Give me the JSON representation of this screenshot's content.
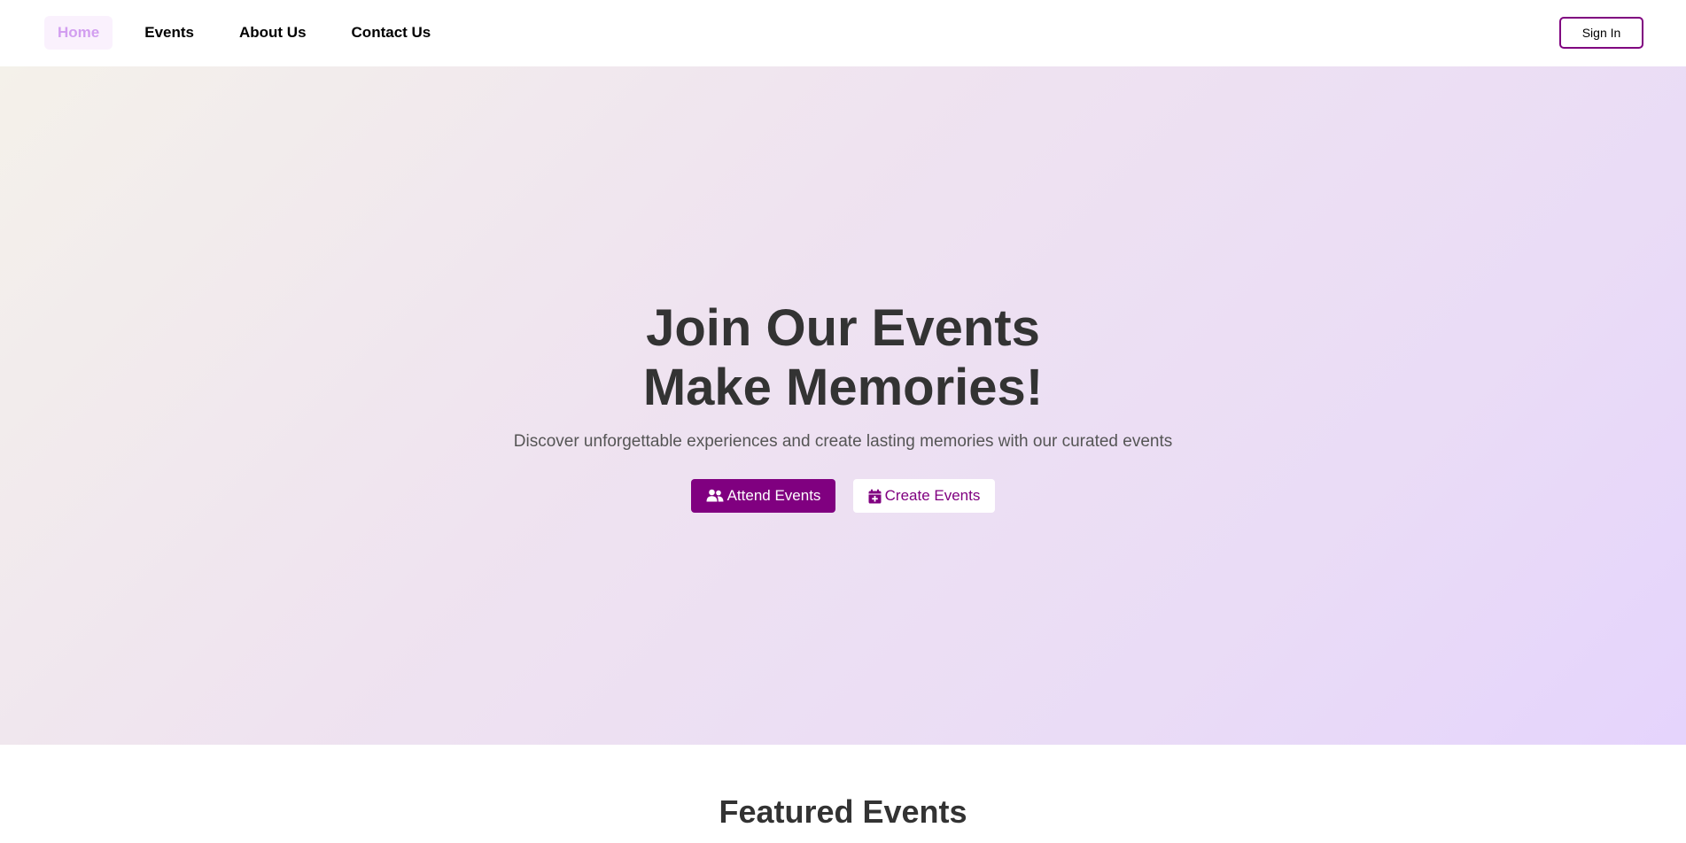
{
  "nav": {
    "links": [
      {
        "label": "Home",
        "active": true
      },
      {
        "label": "Events",
        "active": false
      },
      {
        "label": "About Us",
        "active": false
      },
      {
        "label": "Contact Us",
        "active": false
      }
    ],
    "sign_in_label": "Sign In"
  },
  "hero": {
    "title_line1": "Join Our Events",
    "title_line2": "Make Memories!",
    "subtitle": "Discover unforgettable experiences and create lasting memories with our curated events",
    "attend_label": "Attend Events",
    "attend_icon": "users-icon",
    "create_label": "Create Events",
    "create_icon": "calendar-plus-icon"
  },
  "featured": {
    "title": "Featured Events"
  },
  "colors": {
    "brand": "#800080",
    "active_nav_text": "#d29ef0",
    "active_nav_bg": "#faf1fd",
    "text_dark": "#333333"
  }
}
